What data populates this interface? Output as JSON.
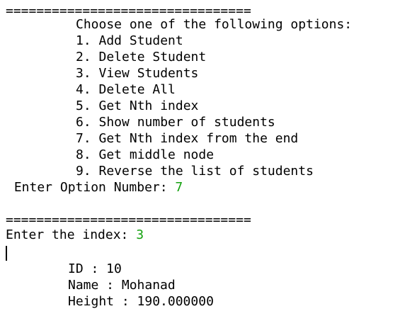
{
  "console": {
    "separator_1": "================================",
    "menu_prompt": "Choose one of the following options:",
    "menu_items": [
      "1. Add Student",
      "2. Delete Student",
      "3. View Students",
      "4. Delete All",
      "5. Get Nth index",
      "6. Show number of students",
      "7. Get Nth index from the end",
      "8. Get middle node",
      "9. Reverse the list of students"
    ],
    "option_prompt": " Enter Option Number: ",
    "option_value": "7",
    "separator_2": "================================",
    "index_prompt": "Enter the index: ",
    "index_value": "3",
    "student_id": "ID : 10",
    "student_name": "Name : Mohanad",
    "student_height": "Height : 190.000000",
    "input_color": "#13a10e"
  }
}
